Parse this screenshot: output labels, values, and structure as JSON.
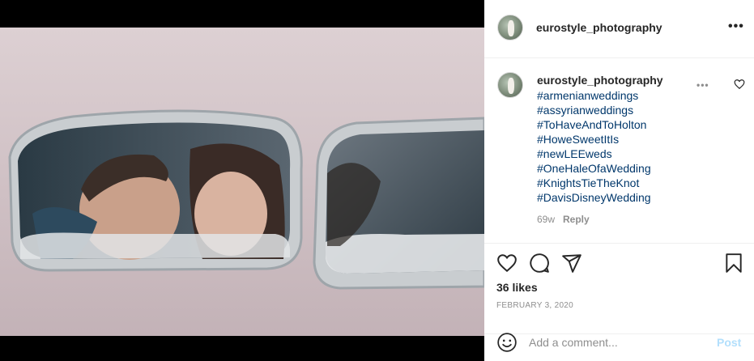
{
  "post": {
    "username": "eurostyle_photography",
    "more_label": "•••"
  },
  "caption": {
    "username": "eurostyle_photography",
    "hashtags": [
      "#armenianweddings",
      "#assyrianweddings",
      "#ToHaveAndToHolton",
      "#HoweSweetItIs",
      "#newLEEweds",
      "#OneHaleOfaWedding",
      "#KnightsTieTheKnot",
      "#DavisDisneyWedding"
    ],
    "age": "69w",
    "reply_label": "Reply",
    "more_label": "•••"
  },
  "actions": {
    "likes": "36 likes",
    "date": "FEBRUARY 3, 2020"
  },
  "add_comment": {
    "placeholder": "Add a comment...",
    "post_label": "Post"
  },
  "colors": {
    "link": "#00376b",
    "muted": "#8e8e8e",
    "post_disabled": "#b2dffc"
  },
  "icons": [
    "heart-icon",
    "comment-icon",
    "share-icon",
    "bookmark-icon",
    "emoji-icon",
    "more-icon",
    "avatar"
  ]
}
